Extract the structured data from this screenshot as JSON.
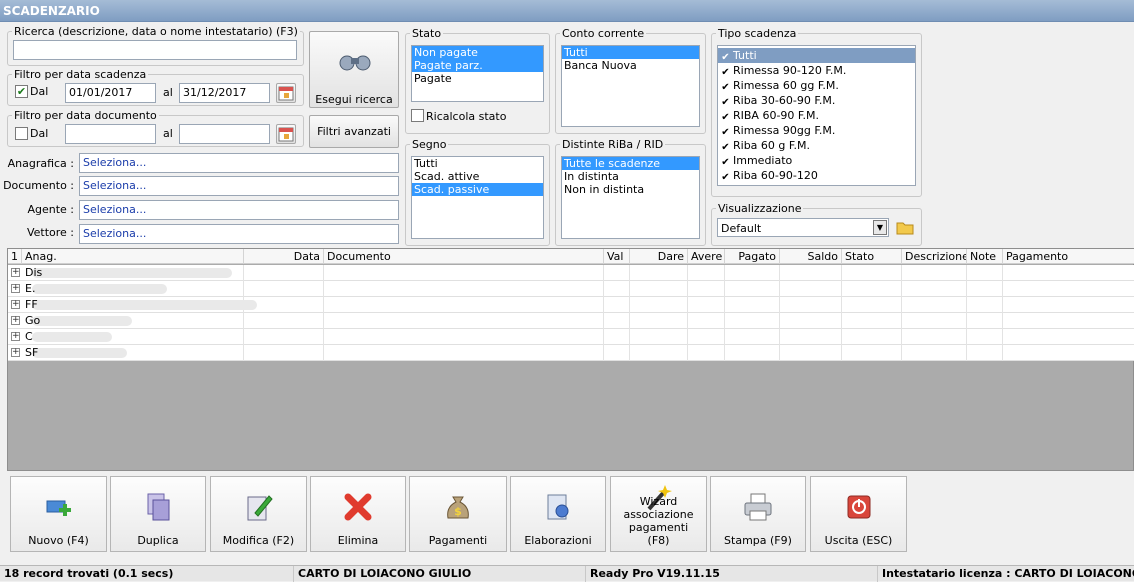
{
  "window": {
    "title": "SCADENZARIO"
  },
  "ricerca": {
    "legend": "Ricerca (descrizione, data o nome intestatario) (F3)",
    "value": ""
  },
  "filtro_scadenza": {
    "legend": "Filtro per data scadenza",
    "dal_label": "Dal",
    "dal_checked": true,
    "dal_value": "01/01/2017",
    "al_label": "al",
    "al_value": "31/12/2017"
  },
  "filtro_documento": {
    "legend": "Filtro per data documento",
    "dal_label": "Dal",
    "dal_checked": false,
    "dal_value": "",
    "al_label": "al",
    "al_value": ""
  },
  "buttons": {
    "esegui": "Esegui ricerca",
    "filtri": "Filtri avanzati"
  },
  "fields": {
    "anagrafica_label": "Anagrafica :",
    "documento_label": "Documento :",
    "agente_label": "Agente :",
    "vettore_label": "Vettore :",
    "placeholder": "Seleziona..."
  },
  "stato": {
    "legend": "Stato",
    "items": [
      "Non pagate",
      "Pagate parz.",
      "Pagate"
    ],
    "selected": [
      0,
      1
    ],
    "ricalcola": "Ricalcola stato"
  },
  "segno": {
    "legend": "Segno",
    "items": [
      "Tutti",
      "Scad. attive",
      "Scad. passive"
    ],
    "selected": [
      2
    ]
  },
  "conto": {
    "legend": "Conto corrente",
    "items": [
      "Tutti",
      "Banca Nuova"
    ],
    "selected": [
      0
    ]
  },
  "distinte": {
    "legend": "Distinte RiBa / RID",
    "items": [
      "Tutte le scadenze",
      "In distinta",
      "Non in distinta"
    ],
    "selected": [
      0
    ]
  },
  "tipo": {
    "legend": "Tipo scadenza",
    "items": [
      "Tutti",
      "Rimessa 90-120 F.M.",
      "Rimessa 60 gg F.M.",
      "Riba 30-60-90 F.M.",
      "RIBA 60-90 F.M.",
      "Rimessa 90gg F.M.",
      "Riba 60 g F.M.",
      "Immediato",
      "Riba 60-90-120"
    ],
    "selected": [
      0
    ]
  },
  "visualizzazione": {
    "legend": "Visualizzazione",
    "value": "Default"
  },
  "grid": {
    "level": "1",
    "columns": [
      "Anag.",
      "Data",
      "Documento",
      "Val",
      "Dare",
      "Avere",
      "Pagato",
      "Saldo",
      "Stato",
      "Descrizione",
      "Note",
      "Pagamento"
    ],
    "rows": [
      {
        "anag": "Dis"
      },
      {
        "anag": "E."
      },
      {
        "anag": "FF"
      },
      {
        "anag": "Go"
      },
      {
        "anag": "C"
      },
      {
        "anag": "SF"
      }
    ]
  },
  "toolbar": [
    {
      "label": "Nuovo (F4)",
      "icon": "new-card-icon"
    },
    {
      "label": "Duplica",
      "icon": "duplicate-icon"
    },
    {
      "label": "Modifica (F2)",
      "icon": "edit-icon"
    },
    {
      "label": "Elimina",
      "icon": "delete-icon"
    },
    {
      "label": "Pagamenti",
      "icon": "money-bag-icon"
    },
    {
      "label": "Elaborazioni",
      "icon": "processing-icon"
    },
    {
      "label": "Wizard associazione pagamenti (F8)",
      "icon": "wizard-wand-icon"
    },
    {
      "label": "Stampa (F9)",
      "icon": "printer-icon"
    },
    {
      "label": "Uscita (ESC)",
      "icon": "exit-icon"
    }
  ],
  "status": {
    "records": "18 record trovati (0.1 secs)",
    "user": "CARTO DI LOIACONO GIULIO",
    "version": "Ready Pro V19.11.15",
    "licenza": "Intestatario licenza : CARTO DI LOIACONO GIULIO"
  }
}
